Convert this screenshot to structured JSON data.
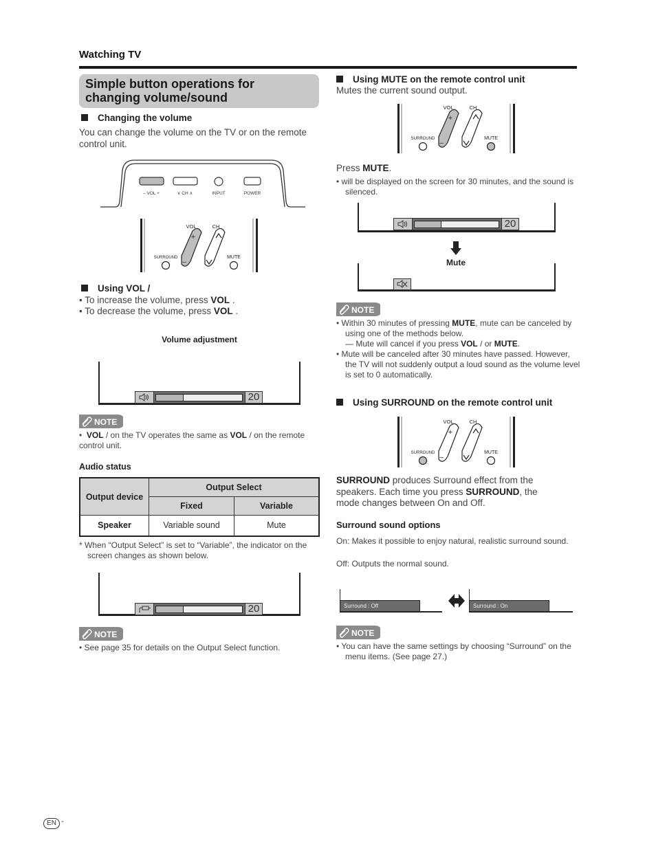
{
  "header": {
    "section": "Watching TV"
  },
  "left": {
    "title": "Simple button operations for changing volume/sound",
    "changing_volume": {
      "heading": "Changing the volume",
      "body": "You can change the volume on the TV or on the remote control unit."
    },
    "tv_panel": {
      "labels": [
        "– VOL +",
        "∨ CH ∧",
        "INPUT",
        "POWER"
      ]
    },
    "remote": {
      "vol": "VOL",
      "ch": "CH",
      "surround": "SURROUND",
      "mute": "MUTE",
      "plus": "+",
      "minus": "–"
    },
    "using_vol": {
      "heading": "Using VOL   /",
      "bullets": [
        {
          "prefix": "• To increase the volume, press ",
          "bold": "VOL",
          "suffix": "   ."
        },
        {
          "prefix": "• To decrease the volume, press ",
          "bold": "VOL",
          "suffix": "   ."
        }
      ]
    },
    "volume_adjustment": {
      "caption": "Volume adjustment",
      "level": 20,
      "fill_fraction": 0.31
    },
    "note1": {
      "badge": "NOTE",
      "bold1": "VOL",
      "text1": "   /     on the TV operates the same as ",
      "bold2": "VOL",
      "text2": "   /     on the remote control unit."
    },
    "audio_status": {
      "heading": "Audio status",
      "table": {
        "col_device": "Output device",
        "col_group": "Output Select",
        "col_fixed": "Fixed",
        "col_variable": "Variable",
        "rows": [
          {
            "device": "Speaker",
            "fixed": "Variable sound",
            "variable": "Mute"
          }
        ]
      },
      "footnote": "*  When “Output Select” is set to “Variable”, the indicator on the screen changes as shown below."
    },
    "variable_osd": {
      "level": 20,
      "fill_fraction": 0.31
    },
    "note2": {
      "badge": "NOTE",
      "text": "•  See page 35 for details on the Output Select function."
    }
  },
  "right": {
    "mute": {
      "heading": "Using MUTE on the remote control unit",
      "body": "Mutes the current sound output.",
      "press_prefix": "Press ",
      "press_bold": "MUTE",
      "press_suffix": ".",
      "bullet": "•        will be displayed on the screen for 30 minutes, and the sound is silenced.",
      "osd_level": 20,
      "osd_fill_fraction": 0.31,
      "arrow_label": "Mute"
    },
    "note3": {
      "badge": "NOTE",
      "b1_prefix": "• Within 30 minutes of pressing ",
      "b1_bold": "MUTE",
      "b1_suffix": ", mute can be canceled by using one of the methods below.",
      "b1_sub_prefix": "— Mute will cancel if you press ",
      "b1_sub_bold1": "VOL",
      "b1_sub_mid": "   /     or ",
      "b1_sub_bold2": "MUTE",
      "b1_sub_suffix": ".",
      "b2": "• Mute will be canceled after 30 minutes have passed. However, the TV will not suddenly output a loud sound as the volume level is set to 0 automatically."
    },
    "surround": {
      "heading": "Using SURROUND on the remote control unit",
      "p_bold1": "SURROUND",
      "p_text1": " produces Surround effect from the speakers. Each time you press ",
      "p_bold2": "SURROUND",
      "p_text2": ", the mode changes between On and Off.",
      "options_heading": "Surround sound options",
      "on_text": "On:  Makes it possible to enjoy natural, realistic surround sound.",
      "off_text": "Off: Outputs the normal sound.",
      "osd_off": "Surround : Off",
      "osd_on": "Surround : On"
    },
    "note4": {
      "badge": "NOTE",
      "text": "• You can have the same settings by choosing “Surround” on the menu items. (See page 27.)"
    }
  },
  "footer": {
    "lang": "EN",
    "dash": "-"
  }
}
